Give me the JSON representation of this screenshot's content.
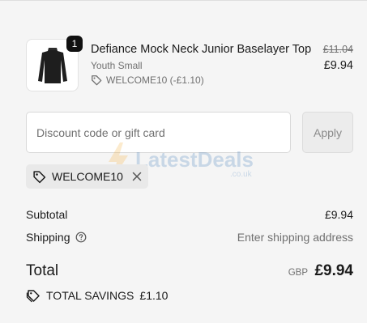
{
  "product": {
    "title": "Defiance Mock Neck Junior Baselayer Top",
    "variant": "Youth Small",
    "discount": "WELCOME10 (-£1.10)",
    "quantity": "1",
    "price_original": "£11.04",
    "price_current": "£9.94",
    "image": "black-long-sleeve-top"
  },
  "discount_form": {
    "placeholder": "Discount code or gift card",
    "value": "",
    "apply_label": "Apply"
  },
  "applied_code": {
    "label": "WELCOME10",
    "tag_icon": "tag-icon",
    "remove_icon": "close-icon"
  },
  "watermark": {
    "text": "LatestDeals",
    "sub": ".co.uk"
  },
  "summary": {
    "subtotal_label": "Subtotal",
    "subtotal_value": "£9.94",
    "shipping_label": "Shipping",
    "shipping_value": "Enter shipping address",
    "total_label": "Total",
    "currency": "GBP",
    "total_value": "£9.94",
    "savings_label": "TOTAL SAVINGS",
    "savings_value": "£1.10"
  },
  "colors": {
    "background": "#f5f5f5",
    "text": "#1a1a1a",
    "muted": "#707070",
    "badge": "#111111"
  }
}
